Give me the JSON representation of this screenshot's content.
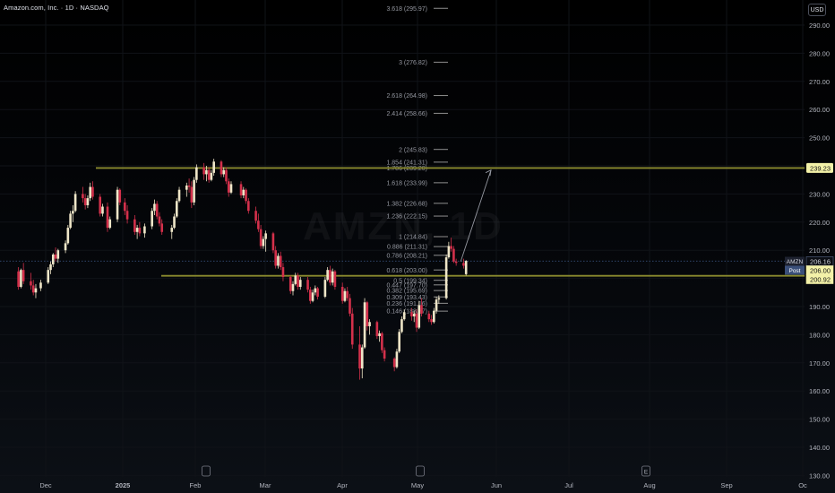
{
  "header": {
    "title": "Amazon.com, Inc. · 1D · NASDAQ",
    "currency_button": "USD"
  },
  "watermark": "AMZN, 1D",
  "chart_data": {
    "type": "candlestick",
    "ylim": [
      130,
      300
    ],
    "y_ticks": [
      130,
      140,
      150,
      160,
      170,
      180,
      190,
      200,
      210,
      220,
      230,
      240,
      250,
      260,
      270,
      280,
      290
    ],
    "x_ticks": [
      "Dec",
      "2025",
      "Feb",
      "Mar",
      "Apr",
      "May",
      "Jun",
      "Jul",
      "Aug",
      "Sep",
      "Oc"
    ],
    "event_markers": [
      {
        "label": "",
        "near": "Feb"
      },
      {
        "label": "",
        "near": "May"
      },
      {
        "label": "E",
        "near": "Aug"
      }
    ],
    "horizontal_levels": [
      {
        "value": 239.23,
        "label": "239.23",
        "color": "#8a8a2e"
      },
      {
        "value": 200.92,
        "label": "200.92",
        "color": "#8a8a2e"
      }
    ],
    "price_labels": [
      {
        "tag": "AMZN",
        "value": "206.16"
      },
      {
        "tag": "Post",
        "value": "206.00"
      },
      {
        "tag": "",
        "value": "200.92"
      }
    ],
    "last_price": 206.16,
    "fibonacci": [
      {
        "ratio": "3.618",
        "value": 295.97
      },
      {
        "ratio": "3",
        "value": 276.82
      },
      {
        "ratio": "2.618",
        "value": 264.98
      },
      {
        "ratio": "2.414",
        "value": 258.66
      },
      {
        "ratio": "2",
        "value": 245.83
      },
      {
        "ratio": "1.854",
        "value": 241.31
      },
      {
        "ratio": "1.786",
        "value": 239.2
      },
      {
        "ratio": "1.618",
        "value": 233.99
      },
      {
        "ratio": "1.382",
        "value": 226.68
      },
      {
        "ratio": "1.236",
        "value": 222.15
      },
      {
        "ratio": "1",
        "value": 214.84
      },
      {
        "ratio": "0.886",
        "value": 211.31
      },
      {
        "ratio": "0.786",
        "value": 208.21
      },
      {
        "ratio": "0.618",
        "value": 203.0
      },
      {
        "ratio": "0.5",
        "value": 199.34
      },
      {
        "ratio": "0.447",
        "value": 197.7
      },
      {
        "ratio": "0.382",
        "value": 195.69
      },
      {
        "ratio": "0.309",
        "value": 193.43
      },
      {
        "ratio": "0.236",
        "value": 191.16
      },
      {
        "ratio": "0.146",
        "value": 188.37
      }
    ],
    "projection": {
      "from": 206.0,
      "to": 238.5
    },
    "colors": {
      "up": "#efe6c8",
      "down": "#d4304b",
      "level": "#8a8a2e",
      "fib": "#8f8f8f",
      "grid": "#101318"
    },
    "candles": [
      {
        "d": "2024-11-20",
        "o": 202.5,
        "h": 204,
        "l": 196,
        "c": 197
      },
      {
        "d": "2024-11-21",
        "o": 197,
        "h": 203.5,
        "l": 196.5,
        "c": 203
      },
      {
        "d": "2024-11-22",
        "o": 203,
        "h": 205.5,
        "l": 198,
        "c": 199
      },
      {
        "d": "2024-11-25",
        "o": 199,
        "h": 202,
        "l": 196,
        "c": 197.5
      },
      {
        "d": "2024-11-26",
        "o": 197.5,
        "h": 199.5,
        "l": 194,
        "c": 195
      },
      {
        "d": "2024-11-27",
        "o": 195,
        "h": 198,
        "l": 193,
        "c": 196.5
      },
      {
        "d": "2024-11-29",
        "o": 196.5,
        "h": 199.5,
        "l": 195.5,
        "c": 198.5
      },
      {
        "d": "2024-12-02",
        "o": 198.5,
        "h": 204,
        "l": 198,
        "c": 203
      },
      {
        "d": "2024-12-03",
        "o": 203,
        "h": 206,
        "l": 201.5,
        "c": 205
      },
      {
        "d": "2024-12-04",
        "o": 205,
        "h": 209,
        "l": 204,
        "c": 208.5
      },
      {
        "d": "2024-12-05",
        "o": 208.5,
        "h": 211,
        "l": 206,
        "c": 207
      },
      {
        "d": "2024-12-06",
        "o": 207,
        "h": 210.5,
        "l": 205.5,
        "c": 210
      },
      {
        "d": "2024-12-09",
        "o": 210,
        "h": 213.5,
        "l": 209,
        "c": 212.5
      },
      {
        "d": "2024-12-10",
        "o": 212.5,
        "h": 219,
        "l": 212,
        "c": 218
      },
      {
        "d": "2024-12-11",
        "o": 218,
        "h": 224,
        "l": 217.5,
        "c": 223
      },
      {
        "d": "2024-12-12",
        "o": 223,
        "h": 226,
        "l": 220,
        "c": 224
      },
      {
        "d": "2024-12-13",
        "o": 224,
        "h": 231,
        "l": 223.5,
        "c": 230
      },
      {
        "d": "2024-12-16",
        "o": 230,
        "h": 232.5,
        "l": 227,
        "c": 228.5
      },
      {
        "d": "2024-12-17",
        "o": 228.5,
        "h": 230,
        "l": 224.5,
        "c": 226
      },
      {
        "d": "2024-12-18",
        "o": 226,
        "h": 229.5,
        "l": 225,
        "c": 228.5
      },
      {
        "d": "2024-12-19",
        "o": 228.5,
        "h": 234,
        "l": 227.5,
        "c": 232.5
      },
      {
        "d": "2024-12-20",
        "o": 232.5,
        "h": 234.5,
        "l": 228,
        "c": 229
      },
      {
        "d": "2024-12-23",
        "o": 229,
        "h": 230,
        "l": 222,
        "c": 223
      },
      {
        "d": "2024-12-24",
        "o": 223,
        "h": 226.5,
        "l": 222,
        "c": 225.5
      },
      {
        "d": "2024-12-26",
        "o": 225.5,
        "h": 227,
        "l": 216.5,
        "c": 218
      },
      {
        "d": "2024-12-27",
        "o": 218,
        "h": 222,
        "l": 217.5,
        "c": 221
      },
      {
        "d": "2024-12-30",
        "o": 221,
        "h": 232.5,
        "l": 220,
        "c": 231.5
      },
      {
        "d": "2024-12-31",
        "o": 231.5,
        "h": 232,
        "l": 226,
        "c": 227
      },
      {
        "d": "2025-01-02",
        "o": 227,
        "h": 228.5,
        "l": 222.5,
        "c": 224
      },
      {
        "d": "2025-01-03",
        "o": 224,
        "h": 226,
        "l": 219.5,
        "c": 221
      },
      {
        "d": "2025-01-06",
        "o": 221,
        "h": 222.5,
        "l": 215.5,
        "c": 216.5
      },
      {
        "d": "2025-01-07",
        "o": 216.5,
        "h": 219,
        "l": 214,
        "c": 218
      },
      {
        "d": "2025-01-08",
        "o": 218,
        "h": 220,
        "l": 215,
        "c": 216
      },
      {
        "d": "2025-01-10",
        "o": 216,
        "h": 219.5,
        "l": 214.5,
        "c": 218.5
      },
      {
        "d": "2025-01-13",
        "o": 218.5,
        "h": 225,
        "l": 217.5,
        "c": 224
      },
      {
        "d": "2025-01-14",
        "o": 224,
        "h": 228,
        "l": 222.5,
        "c": 226.5
      },
      {
        "d": "2025-01-15",
        "o": 226.5,
        "h": 227.5,
        "l": 221,
        "c": 222
      },
      {
        "d": "2025-01-16",
        "o": 222,
        "h": 223.5,
        "l": 218.5,
        "c": 219.5
      },
      {
        "d": "2025-01-17",
        "o": 219.5,
        "h": 221,
        "l": 215.5,
        "c": 216.5
      },
      {
        "d": "2025-01-21",
        "o": 216.5,
        "h": 219,
        "l": 214,
        "c": 218
      },
      {
        "d": "2025-01-22",
        "o": 218,
        "h": 223,
        "l": 217.5,
        "c": 222
      },
      {
        "d": "2025-01-23",
        "o": 222,
        "h": 228.5,
        "l": 221.5,
        "c": 227.5
      },
      {
        "d": "2025-01-24",
        "o": 227.5,
        "h": 232.5,
        "l": 227,
        "c": 231.5
      },
      {
        "d": "2025-01-27",
        "o": 231.5,
        "h": 234,
        "l": 229,
        "c": 233
      },
      {
        "d": "2025-01-28",
        "o": 233,
        "h": 235.5,
        "l": 230.5,
        "c": 232.5
      },
      {
        "d": "2025-01-29",
        "o": 232.5,
        "h": 234.5,
        "l": 225,
        "c": 227
      },
      {
        "d": "2025-01-30",
        "o": 227,
        "h": 236,
        "l": 226,
        "c": 235
      },
      {
        "d": "2025-01-31",
        "o": 235,
        "h": 240.5,
        "l": 234,
        "c": 239.5
      },
      {
        "d": "2025-02-03",
        "o": 239.5,
        "h": 241,
        "l": 235,
        "c": 237
      },
      {
        "d": "2025-02-04",
        "o": 237,
        "h": 240,
        "l": 234.5,
        "c": 238.5
      },
      {
        "d": "2025-02-05",
        "o": 238.5,
        "h": 239.5,
        "l": 234,
        "c": 235
      },
      {
        "d": "2025-02-06",
        "o": 235,
        "h": 238.5,
        "l": 234.5,
        "c": 237.5
      },
      {
        "d": "2025-02-07",
        "o": 237.5,
        "h": 242.5,
        "l": 236.5,
        "c": 241.5
      },
      {
        "d": "2025-02-10",
        "o": 241.5,
        "h": 242,
        "l": 236,
        "c": 237
      },
      {
        "d": "2025-02-11",
        "o": 237,
        "h": 239.5,
        "l": 236,
        "c": 238.5
      },
      {
        "d": "2025-02-12",
        "o": 238.5,
        "h": 239.5,
        "l": 233.5,
        "c": 234.5
      },
      {
        "d": "2025-02-13",
        "o": 234.5,
        "h": 235.5,
        "l": 229,
        "c": 230.5
      },
      {
        "d": "2025-02-14",
        "o": 230.5,
        "h": 234.5,
        "l": 230,
        "c": 233.5
      },
      {
        "d": "2025-02-18",
        "o": 233.5,
        "h": 234.5,
        "l": 228.5,
        "c": 229.5
      },
      {
        "d": "2025-02-19",
        "o": 229.5,
        "h": 232.5,
        "l": 228.5,
        "c": 231.5
      },
      {
        "d": "2025-02-20",
        "o": 231.5,
        "h": 232,
        "l": 226.5,
        "c": 227.5
      },
      {
        "d": "2025-02-21",
        "o": 227.5,
        "h": 228.5,
        "l": 223,
        "c": 224
      },
      {
        "d": "2025-02-24",
        "o": 224,
        "h": 225.5,
        "l": 219.5,
        "c": 220.5
      },
      {
        "d": "2025-02-25",
        "o": 220.5,
        "h": 223,
        "l": 216.5,
        "c": 217.5
      },
      {
        "d": "2025-02-26",
        "o": 217.5,
        "h": 219,
        "l": 210.5,
        "c": 211.5
      },
      {
        "d": "2025-02-27",
        "o": 211.5,
        "h": 215,
        "l": 210.5,
        "c": 214
      },
      {
        "d": "2025-02-28",
        "o": 214,
        "h": 217,
        "l": 209.5,
        "c": 216
      },
      {
        "d": "2025-03-03",
        "o": 216,
        "h": 216.5,
        "l": 209,
        "c": 210
      },
      {
        "d": "2025-03-04",
        "o": 210,
        "h": 211.5,
        "l": 203.5,
        "c": 204.5
      },
      {
        "d": "2025-03-05",
        "o": 204.5,
        "h": 209,
        "l": 203.5,
        "c": 208
      },
      {
        "d": "2025-03-06",
        "o": 208,
        "h": 209.5,
        "l": 203,
        "c": 204
      },
      {
        "d": "2025-03-07",
        "o": 204,
        "h": 205.5,
        "l": 199,
        "c": 200.5
      },
      {
        "d": "2025-03-10",
        "o": 200.5,
        "h": 201,
        "l": 194.5,
        "c": 195.5
      },
      {
        "d": "2025-03-11",
        "o": 195.5,
        "h": 199,
        "l": 194,
        "c": 198
      },
      {
        "d": "2025-03-12",
        "o": 198,
        "h": 202,
        "l": 197.5,
        "c": 201
      },
      {
        "d": "2025-03-13",
        "o": 201,
        "h": 202,
        "l": 196,
        "c": 197
      },
      {
        "d": "2025-03-14",
        "o": 197,
        "h": 200.5,
        "l": 196,
        "c": 199.5
      },
      {
        "d": "2025-03-17",
        "o": 199.5,
        "h": 200.5,
        "l": 195,
        "c": 196
      },
      {
        "d": "2025-03-18",
        "o": 196,
        "h": 197,
        "l": 191,
        "c": 192
      },
      {
        "d": "2025-03-19",
        "o": 192,
        "h": 196,
        "l": 191.5,
        "c": 195
      },
      {
        "d": "2025-03-20",
        "o": 195,
        "h": 197.5,
        "l": 194,
        "c": 196.5
      },
      {
        "d": "2025-03-21",
        "o": 196.5,
        "h": 197,
        "l": 192.5,
        "c": 193.5
      },
      {
        "d": "2025-03-24",
        "o": 193.5,
        "h": 200.5,
        "l": 193,
        "c": 199.5
      },
      {
        "d": "2025-03-25",
        "o": 199.5,
        "h": 204,
        "l": 199,
        "c": 203
      },
      {
        "d": "2025-03-26",
        "o": 203,
        "h": 204.5,
        "l": 197.5,
        "c": 198.5
      },
      {
        "d": "2025-03-27",
        "o": 198.5,
        "h": 203.5,
        "l": 197.5,
        "c": 202.5
      },
      {
        "d": "2025-03-28",
        "o": 202.5,
        "h": 203,
        "l": 196,
        "c": 197
      },
      {
        "d": "2025-03-31",
        "o": 197,
        "h": 198.5,
        "l": 191,
        "c": 192
      },
      {
        "d": "2025-04-01",
        "o": 192,
        "h": 196.5,
        "l": 191.5,
        "c": 195.5
      },
      {
        "d": "2025-04-02",
        "o": 195.5,
        "h": 197,
        "l": 192,
        "c": 193
      },
      {
        "d": "2025-04-03",
        "o": 193,
        "h": 194.5,
        "l": 186.5,
        "c": 187.5
      },
      {
        "d": "2025-04-04",
        "o": 187.5,
        "h": 189.5,
        "l": 175,
        "c": 176.5
      },
      {
        "d": "2025-04-07",
        "o": 176.5,
        "h": 183,
        "l": 164,
        "c": 168
      },
      {
        "d": "2025-04-08",
        "o": 168,
        "h": 176.5,
        "l": 164.5,
        "c": 175.5
      },
      {
        "d": "2025-04-09",
        "o": 175.5,
        "h": 193,
        "l": 175,
        "c": 191.5
      },
      {
        "d": "2025-04-10",
        "o": 191.5,
        "h": 192,
        "l": 181.5,
        "c": 183
      },
      {
        "d": "2025-04-11",
        "o": 183,
        "h": 185.5,
        "l": 180,
        "c": 184.5
      },
      {
        "d": "2025-04-14",
        "o": 184.5,
        "h": 185,
        "l": 178.5,
        "c": 179.5
      },
      {
        "d": "2025-04-15",
        "o": 179.5,
        "h": 181.5,
        "l": 177.5,
        "c": 180.5
      },
      {
        "d": "2025-04-16",
        "o": 180.5,
        "h": 181,
        "l": 173.5,
        "c": 174.5
      },
      {
        "d": "2025-04-17",
        "o": 174.5,
        "h": 175.5,
        "l": 170.5,
        "c": 171.5
      },
      {
        "d": "2025-04-21",
        "o": 171.5,
        "h": 172,
        "l": 167,
        "c": 168.5
      },
      {
        "d": "2025-04-22",
        "o": 168.5,
        "h": 175,
        "l": 168,
        "c": 174
      },
      {
        "d": "2025-04-23",
        "o": 174,
        "h": 182,
        "l": 173.5,
        "c": 181
      },
      {
        "d": "2025-04-24",
        "o": 181,
        "h": 186.5,
        "l": 180.5,
        "c": 185.5
      },
      {
        "d": "2025-04-25",
        "o": 185.5,
        "h": 189,
        "l": 185,
        "c": 188
      },
      {
        "d": "2025-04-28",
        "o": 188,
        "h": 189.5,
        "l": 185,
        "c": 186.5
      },
      {
        "d": "2025-04-29",
        "o": 186.5,
        "h": 188.5,
        "l": 184.5,
        "c": 187.5
      },
      {
        "d": "2025-04-30",
        "o": 187.5,
        "h": 189,
        "l": 181,
        "c": 182.5
      },
      {
        "d": "2025-05-01",
        "o": 182.5,
        "h": 192,
        "l": 182,
        "c": 190.5
      },
      {
        "d": "2025-05-02",
        "o": 190.5,
        "h": 193,
        "l": 186.5,
        "c": 187.5
      },
      {
        "d": "2025-05-05",
        "o": 187.5,
        "h": 188.5,
        "l": 184.5,
        "c": 185.5
      },
      {
        "d": "2025-05-06",
        "o": 185.5,
        "h": 187,
        "l": 183.5,
        "c": 184.5
      },
      {
        "d": "2025-05-07",
        "o": 184.5,
        "h": 189.5,
        "l": 184,
        "c": 188.5
      },
      {
        "d": "2025-05-08",
        "o": 188.5,
        "h": 193.5,
        "l": 187.5,
        "c": 192.5
      },
      {
        "d": "2025-05-09",
        "o": 192.5,
        "h": 194,
        "l": 191,
        "c": 193
      },
      {
        "d": "2025-05-12",
        "o": 193,
        "h": 208.5,
        "l": 192.5,
        "c": 207.5
      },
      {
        "d": "2025-05-13",
        "o": 207.5,
        "h": 213,
        "l": 207,
        "c": 211.5
      },
      {
        "d": "2025-05-14",
        "o": 211.5,
        "h": 214.5,
        "l": 209.5,
        "c": 210.5
      },
      {
        "d": "2025-05-15",
        "o": 210.5,
        "h": 211.5,
        "l": 205.5,
        "c": 206
      },
      {
        "d": "2025-05-16",
        "o": 206,
        "h": 207,
        "l": 204.5,
        "c": 205.5
      },
      {
        "d": "2025-05-19",
        "o": 205.5,
        "h": 207,
        "l": 203.5,
        "c": 204.5
      },
      {
        "d": "2025-05-20",
        "o": 201.5,
        "h": 206.5,
        "l": 201,
        "c": 206.2
      }
    ]
  }
}
